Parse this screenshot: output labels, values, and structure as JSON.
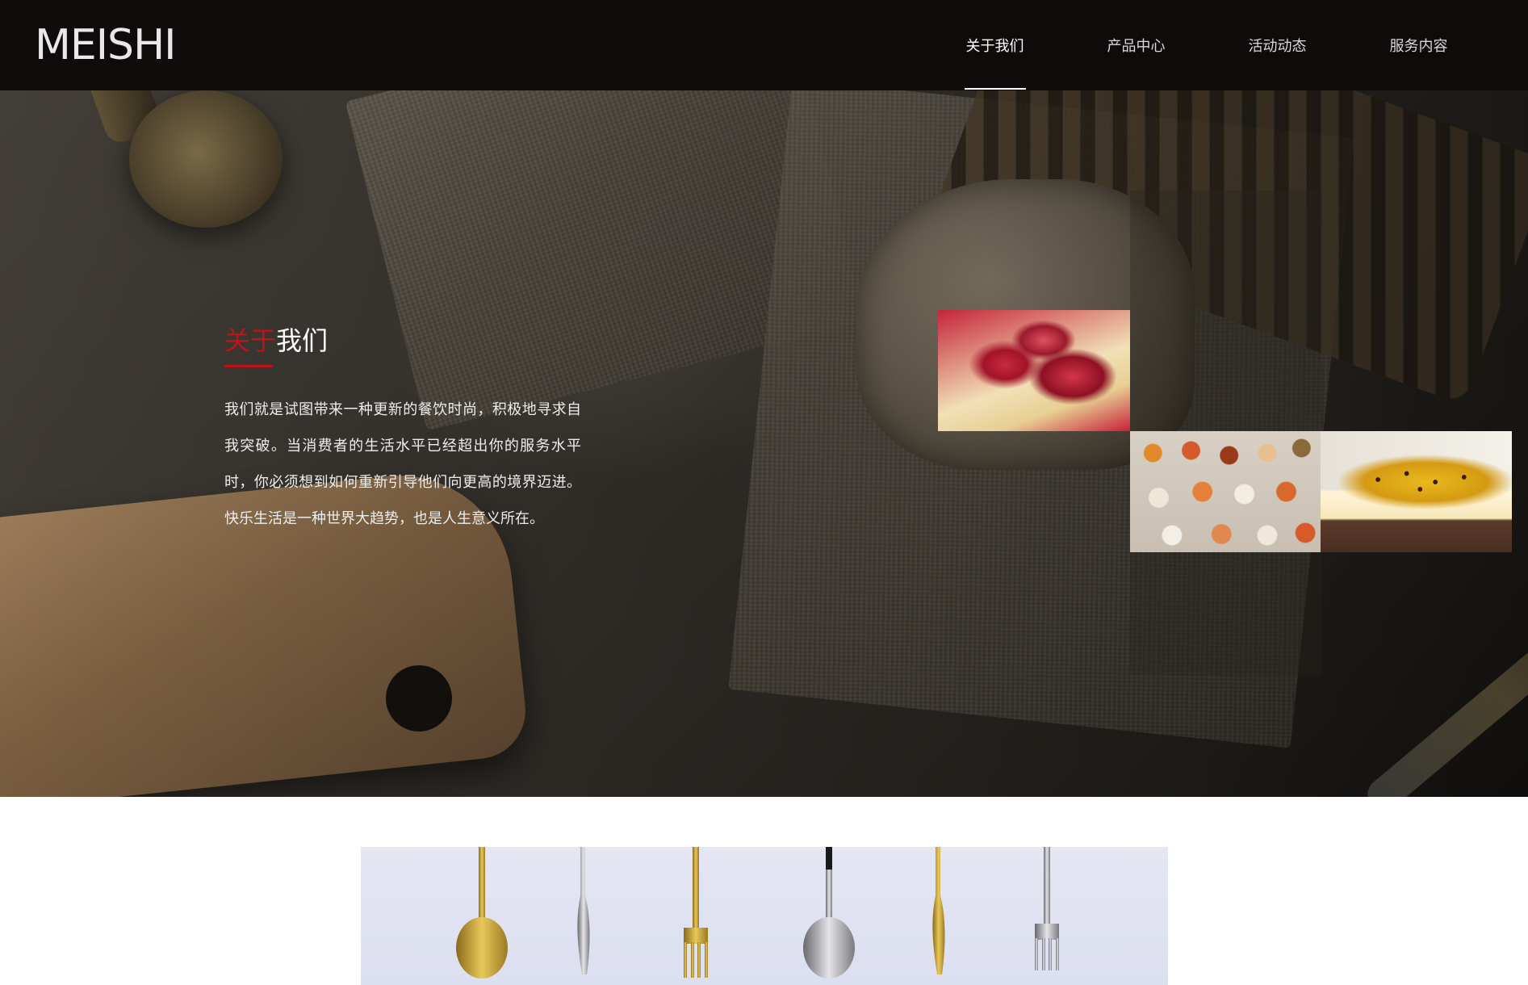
{
  "header": {
    "logo_text": "MEISHI",
    "nav": [
      {
        "label": "关于我们",
        "active": true
      },
      {
        "label": "产品中心",
        "active": false
      },
      {
        "label": "活动动态",
        "active": false
      },
      {
        "label": "服务内容",
        "active": false
      }
    ]
  },
  "about": {
    "title_highlight": "关于",
    "title_rest": "我们",
    "text": "我们就是试图带来一种更新的餐饮时尚，积极地寻求自我突破。当消费者的生活水平已经超出你的服务水平时，你必须想到如何重新引导他们向更高的境界迈进。快乐生活是一种世界大趋势，也是人生意义所在。"
  },
  "colors": {
    "accent_red": "#c1121a",
    "header_bg": "#0e0b0a"
  },
  "images": {
    "tile_1": "red-fruit-tart-photo",
    "tile_2": "dim-sum-assortment-photo",
    "tile_3": "passion-fruit-mousse-cake-photo",
    "banner": "cutlery-banner-photo"
  }
}
